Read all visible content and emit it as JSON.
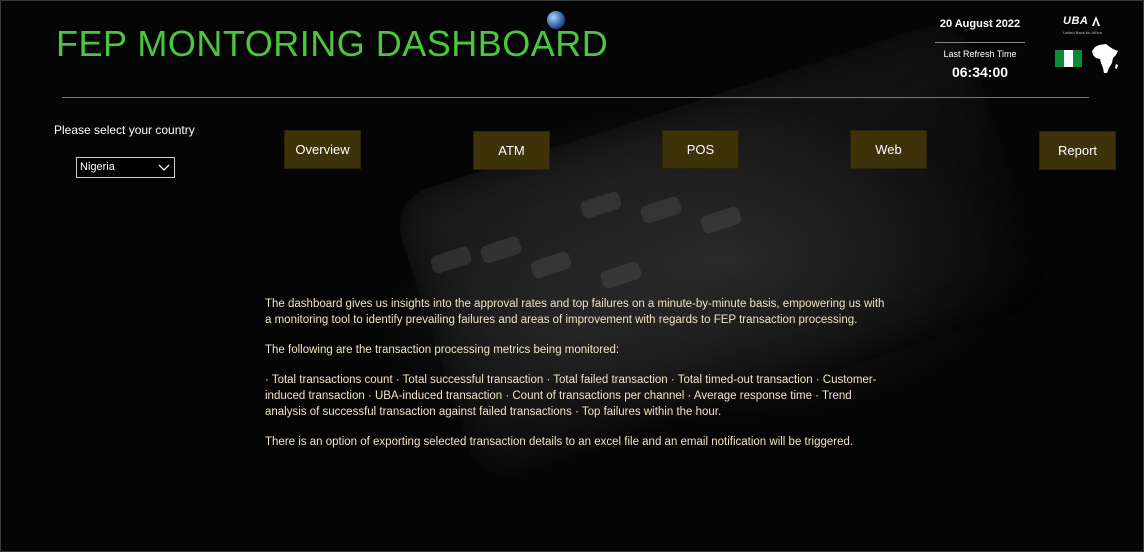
{
  "header": {
    "title": "FEP MONTORING DASHBOARD",
    "date": "20 August 2022",
    "refresh_label": "Last Refresh Time",
    "refresh_time": "06:34:00",
    "brand_name": "UBA",
    "brand_tagline": "United Bank for Africa"
  },
  "country": {
    "label": "Please select your country",
    "selected": "Nigeria"
  },
  "nav": {
    "overview": "Overview",
    "atm": "ATM",
    "pos": "POS",
    "web": "Web",
    "report": "Report"
  },
  "description": {
    "para1": "The dashboard gives us insights into the approval rates and top failures on a minute-by-minute basis, empowering us with a monitoring tool to identify prevailing failures and areas of improvement with regards to FEP transaction processing.",
    "para2": "The following are the transaction processing metrics being monitored:",
    "para3": "· Total transactions count  · Total successful transaction  · Total failed transaction  · Total timed-out transaction  · Customer-induced transaction  · UBA-induced transaction  · Count of transactions per channel  · Average response time  · Trend analysis of successful transaction against failed transactions  · Top failures within the hour.",
    "para4": "There is an option of exporting selected transaction details to an excel file and an email notification will be triggered."
  },
  "colors": {
    "title": "#4bc63e",
    "button_bg": "#3d320a",
    "divider": "#8a7a3a",
    "description_text": "#f2e3c4"
  }
}
